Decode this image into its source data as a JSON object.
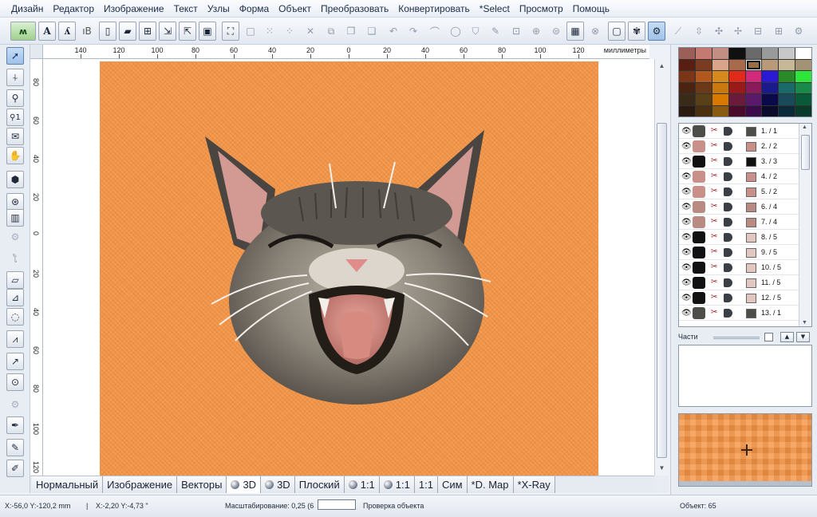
{
  "menu": [
    "Дизайн",
    "Редактор",
    "Изображение",
    "Текст",
    "Узлы",
    "Форма",
    "Объект",
    "Преобразовать",
    "Конвертировать",
    "*Select",
    "Просмотр",
    "Помощь"
  ],
  "toolbar": {
    "icons": [
      "stitch-logo-icon",
      "text-icon",
      "text-tool-icon",
      "text-block-icon",
      "new-file-icon",
      "open-file-icon",
      "open-add-icon",
      "import-icon",
      "import-image-icon",
      "save-icon",
      "select-frame-icon",
      "rect-select-icon",
      "dots-select-icon",
      "cut-icon",
      "copy-icon",
      "paste-icon",
      "undo-icon",
      "redo-icon",
      "node-icon",
      "shape-icon",
      "shirt-icon",
      "picker-icon",
      "transform-icon",
      "stamp-icon",
      "view-icon",
      "frame-icon",
      "hoop-icon",
      "print-icon",
      "settings-icon",
      "arrow-icon",
      "scale-icon",
      "align-icon",
      "rotate-icon",
      "mirror-icon",
      "gear-icon"
    ]
  },
  "lefttools": {
    "icons": [
      "select-arrow-icon",
      "node-edit-icon",
      "zoom-icon",
      "zoom-one-icon",
      "lasso-icon",
      "hand-icon",
      "fill-icon",
      "satin-icon",
      "gear-disabled-icon",
      "spiral-icon",
      "column-icon",
      "ribbon-icon",
      "curve-icon",
      "zigzag-icon",
      "line-icon",
      "stamp-icon",
      "gear-disabled-icon",
      "pen-icon",
      "brush-icon",
      "pencil-icon"
    ]
  },
  "ruler": {
    "units": "миллиметры",
    "top_ticks": [
      "140",
      "120",
      "100",
      "80",
      "60",
      "40",
      "20",
      "0",
      "20",
      "40",
      "60",
      "80",
      "100",
      "120"
    ],
    "left_ticks": [
      "80",
      "60",
      "40",
      "20",
      "0",
      "20",
      "40",
      "60",
      "80",
      "100",
      "120"
    ]
  },
  "tabs": [
    {
      "label": "Нормальный",
      "ball": false,
      "active": false
    },
    {
      "label": "Изображение",
      "ball": false,
      "active": false
    },
    {
      "label": "Векторы",
      "ball": false,
      "active": false
    },
    {
      "label": "3D",
      "ball": true,
      "active": true
    },
    {
      "label": "3D",
      "ball": true,
      "active": false
    },
    {
      "label": "Плоский",
      "ball": false,
      "active": false
    },
    {
      "label": "1:1",
      "ball": true,
      "active": false
    },
    {
      "label": "1:1",
      "ball": true,
      "active": false
    },
    {
      "label": "1:1",
      "ball": false,
      "active": false
    },
    {
      "label": "Сим",
      "ball": false,
      "active": false
    },
    {
      "label": "*D. Map",
      "ball": false,
      "active": false
    },
    {
      "label": "*X-Ray",
      "ball": false,
      "active": false
    }
  ],
  "status": {
    "coords1": "X:-56,0  Y:-120,2 mm",
    "coords2": "X:-2,20  Y:-4,73 \"",
    "zoom": "Масштабирование: 0,25 (6",
    "check": "Проверка объекта",
    "object": "Объект: 65"
  },
  "palette": [
    "#9b5f58",
    "#c47a70",
    "#c29083",
    "#101010",
    "#6a6a6a",
    "#9a9a9a",
    "#c8c8c8",
    "#ffffff",
    "#5a1d12",
    "#7a3c20",
    "#d9a48a",
    "#a76a4a",
    "#9a6d44",
    "#b89a78",
    "#c8b89a",
    "#a49275",
    "#7a3518",
    "#b05820",
    "#d68a1e",
    "#e12a1a",
    "#d22a7a",
    "#2a1ad8",
    "#2a8a2a",
    "#2ee63a",
    "#4a2410",
    "#6a3a18",
    "#c87a10",
    "#9a1a1a",
    "#8a1a5a",
    "#1a1a8a",
    "#1a6a6a",
    "#1a8a4a",
    "#3a2a18",
    "#5a4018",
    "#d87a00",
    "#6a1a3a",
    "#5a1a6a",
    "#0a0a4a",
    "#1a4a5a",
    "#0a5a3a",
    "#2a1a10",
    "#4a3010",
    "#8a5a10",
    "#4a0a2a",
    "#3a0a4a",
    "#0a0a2a",
    "#0a2a3a",
    "#0a3a2a"
  ],
  "palette_selected_index": 12,
  "objects": [
    {
      "num": "1. / 1",
      "color": "#4d4d4a",
      "dark": false
    },
    {
      "num": "2. / 2",
      "color": "#c9908a",
      "dark": false
    },
    {
      "num": "3. / 3",
      "color": "#111111",
      "dark": true
    },
    {
      "num": "4. / 2",
      "color": "#c9908a",
      "dark": false
    },
    {
      "num": "5. / 2",
      "color": "#c9908a",
      "dark": false
    },
    {
      "num": "6. / 4",
      "color": "#b98a82",
      "dark": false
    },
    {
      "num": "7. / 4",
      "color": "#b98a82",
      "dark": false
    },
    {
      "num": "8. / 5",
      "color": "#e2c6c0",
      "dark": true
    },
    {
      "num": "9. / 5",
      "color": "#e2c6c0",
      "dark": true
    },
    {
      "num": "10. / 5",
      "color": "#e2c6c0",
      "dark": true
    },
    {
      "num": "11. / 5",
      "color": "#e2c6c0",
      "dark": true
    },
    {
      "num": "12. / 5",
      "color": "#e2c6c0",
      "dark": true
    },
    {
      "num": "13. / 1",
      "color": "#4d4d4a",
      "dark": false
    }
  ],
  "parts_label": "Части"
}
